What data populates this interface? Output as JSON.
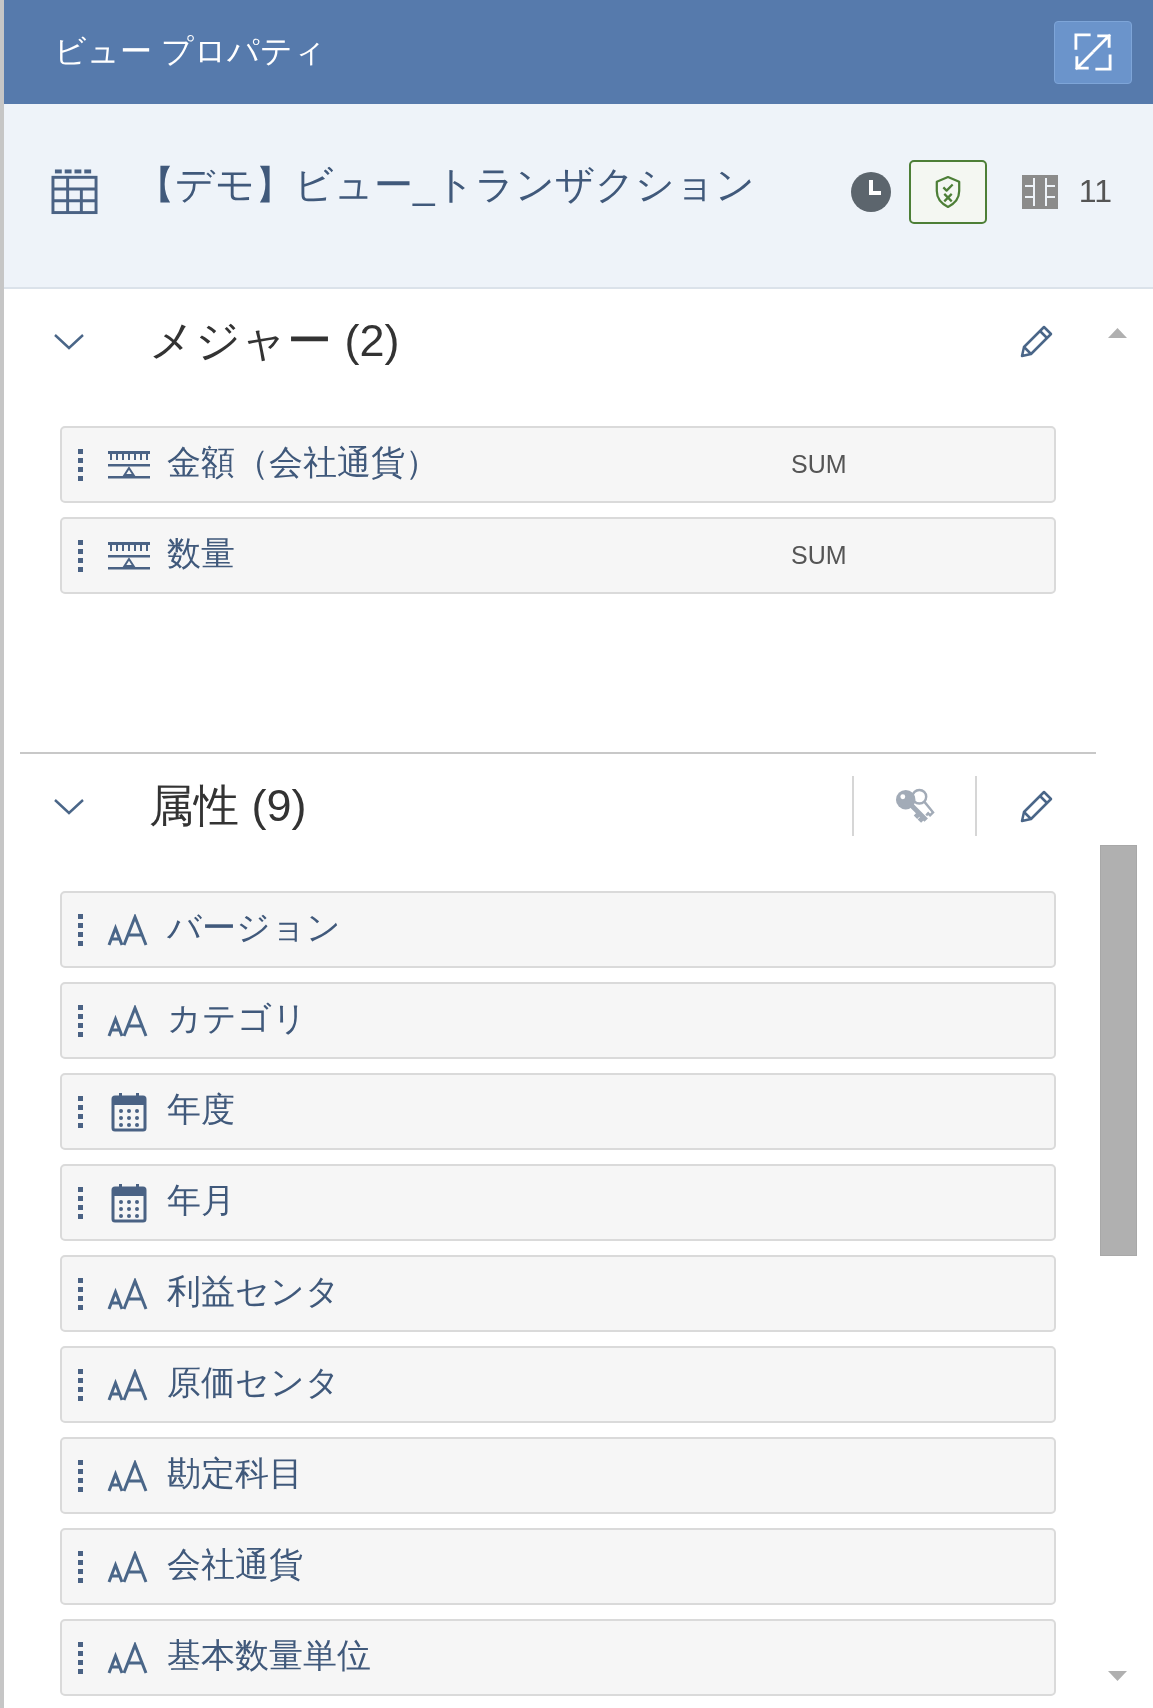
{
  "header": {
    "title": "ビュー プロパティ"
  },
  "view": {
    "title": "【デモ】ビュー_トランザクション",
    "column_count": "11"
  },
  "sections": [
    {
      "kind": "measures",
      "title": "メジャー (2)",
      "expanded": true,
      "items": [
        {
          "kind": "measure",
          "name": "金額（会社通貨）",
          "aggregation": "SUM"
        },
        {
          "kind": "measure",
          "name": "数量",
          "aggregation": "SUM"
        }
      ]
    },
    {
      "kind": "attributes",
      "title": "属性 (9)",
      "expanded": true,
      "items": [
        {
          "kind": "text",
          "name": "バージョン"
        },
        {
          "kind": "text",
          "name": "カテゴリ"
        },
        {
          "kind": "date",
          "name": "年度"
        },
        {
          "kind": "date",
          "name": "年月"
        },
        {
          "kind": "text",
          "name": "利益センタ"
        },
        {
          "kind": "text",
          "name": "原価センタ"
        },
        {
          "kind": "text",
          "name": "勘定科目"
        },
        {
          "kind": "text",
          "name": "会社通貨"
        },
        {
          "kind": "text",
          "name": "基本数量単位"
        }
      ]
    }
  ]
}
